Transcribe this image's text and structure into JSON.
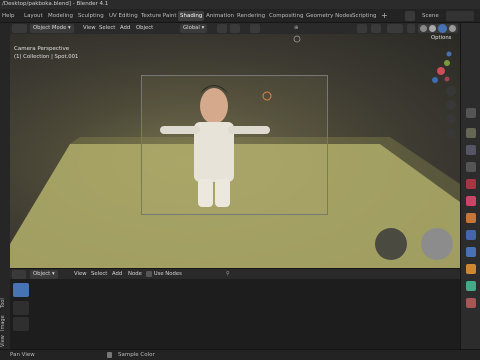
{
  "window": {
    "title": "/Desktop/pakboka.blend] - Blender 4.1"
  },
  "menu": {
    "help": "Help"
  },
  "workspaces": [
    "Layout",
    "Modeling",
    "Sculpting",
    "UV Editing",
    "Texture Paint",
    "Shading",
    "Animation",
    "Rendering",
    "Compositing",
    "Geometry Nodes",
    "Scripting"
  ],
  "active_workspace": "Shading",
  "scene": {
    "label": "Scene"
  },
  "viewport_header": {
    "mode": "Object Mode",
    "menus": [
      "View",
      "Select",
      "Add",
      "Object"
    ],
    "transform": "Global",
    "options": "Options"
  },
  "viewport_overlay": {
    "view_name": "Camera Perspective",
    "collection": "(1) Collection | Spot.001"
  },
  "node_header": {
    "type": "Object",
    "menus": [
      "View",
      "Select",
      "Add",
      "Node"
    ],
    "use_nodes": "Use Nodes"
  },
  "side_tabs": [
    "Tool",
    "Image",
    "View"
  ],
  "status": {
    "pan": "Pan View",
    "sample": "Sample Color"
  },
  "colors": {
    "accent": "#4772b3",
    "active_tab": "#3f3f3f",
    "floor": "#b1ad6a"
  }
}
